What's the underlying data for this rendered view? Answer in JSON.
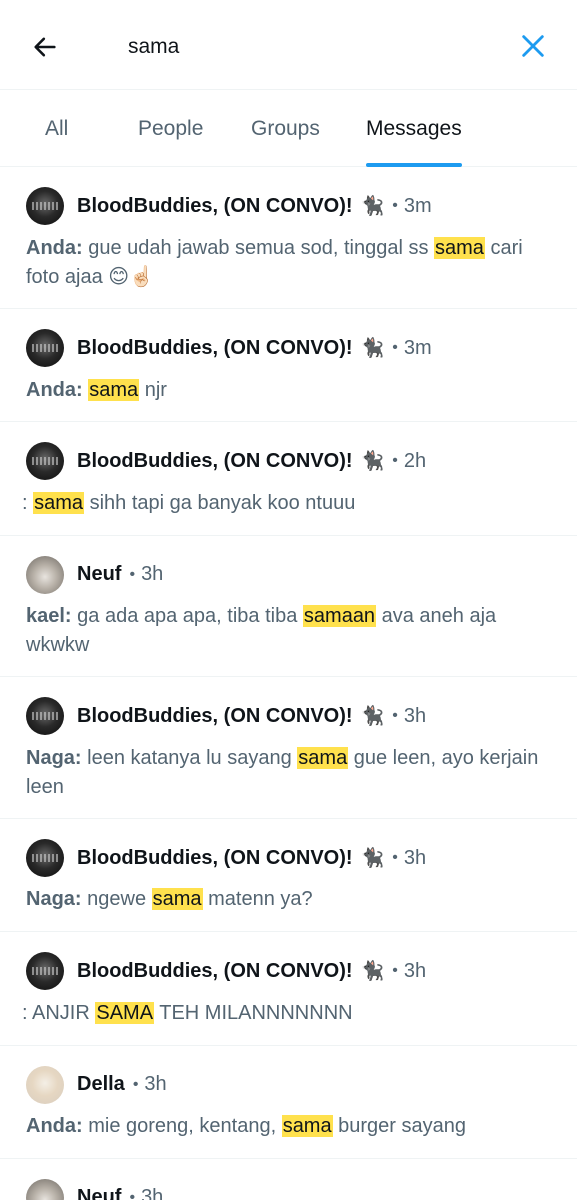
{
  "search": {
    "query": "sama"
  },
  "tabs": [
    {
      "label": "All"
    },
    {
      "label": "People"
    },
    {
      "label": "Groups"
    },
    {
      "label": "Messages"
    }
  ],
  "results": [
    {
      "name": "BloodBuddies, (ON CONVO)!",
      "emoji": "🐈‍⬛",
      "time": "3m",
      "sender": "Anda:",
      "pre": " gue udah jawab semua sod, tinggal ss ",
      "match": "sama",
      "post": " cari foto ajaa 😊☝🏻"
    },
    {
      "name": "BloodBuddies, (ON CONVO)!",
      "emoji": "🐈‍⬛",
      "time": "3m",
      "sender": "Anda:",
      "pre": " ",
      "match": "sama",
      "post": " njr"
    },
    {
      "name": "BloodBuddies, (ON CONVO)!",
      "emoji": "🐈‍⬛",
      "time": "2h",
      "sender": "",
      "pre": ": ",
      "match": "sama",
      "post": " sihh tapi ga banyak koo ntuuu"
    },
    {
      "name": "Neuf",
      "emoji": "",
      "time": "3h",
      "sender": "kael:",
      "pre": " ga ada apa apa, tiba tiba ",
      "match": "samaan",
      "post": " ava aneh aja wkwkw"
    },
    {
      "name": "BloodBuddies, (ON CONVO)!",
      "emoji": "🐈‍⬛",
      "time": "3h",
      "sender": "Naga:",
      "pre": " leen katanya lu sayang ",
      "match": "sama",
      "post": " gue leen, ayo kerjain leen"
    },
    {
      "name": "BloodBuddies, (ON CONVO)!",
      "emoji": "🐈‍⬛",
      "time": "3h",
      "sender": "Naga:",
      "pre": " ngewe ",
      "match": "sama",
      "post": " matenn ya?"
    },
    {
      "name": "BloodBuddies, (ON CONVO)!",
      "emoji": "🐈‍⬛",
      "time": "3h",
      "sender": "",
      "pre": ": ANJIR ",
      "match": "SAMA",
      "post": " TEH MILANNNNNNN"
    },
    {
      "name": "Della",
      "emoji": "",
      "time": "3h",
      "sender": "Anda:",
      "pre": " mie goreng, kentang, ",
      "match": "sama",
      "post": " burger sayang"
    },
    {
      "name": "Neuf",
      "emoji": "",
      "time": "3h",
      "sender": "",
      "pre": "",
      "match": "",
      "post": ""
    }
  ],
  "separator": "•",
  "colors": {
    "accent": "#1d9bf0",
    "highlight": "#ffe14d",
    "secondary_text": "#536471"
  },
  "icons": {
    "back": "arrow-left-icon",
    "clear": "close-icon"
  }
}
